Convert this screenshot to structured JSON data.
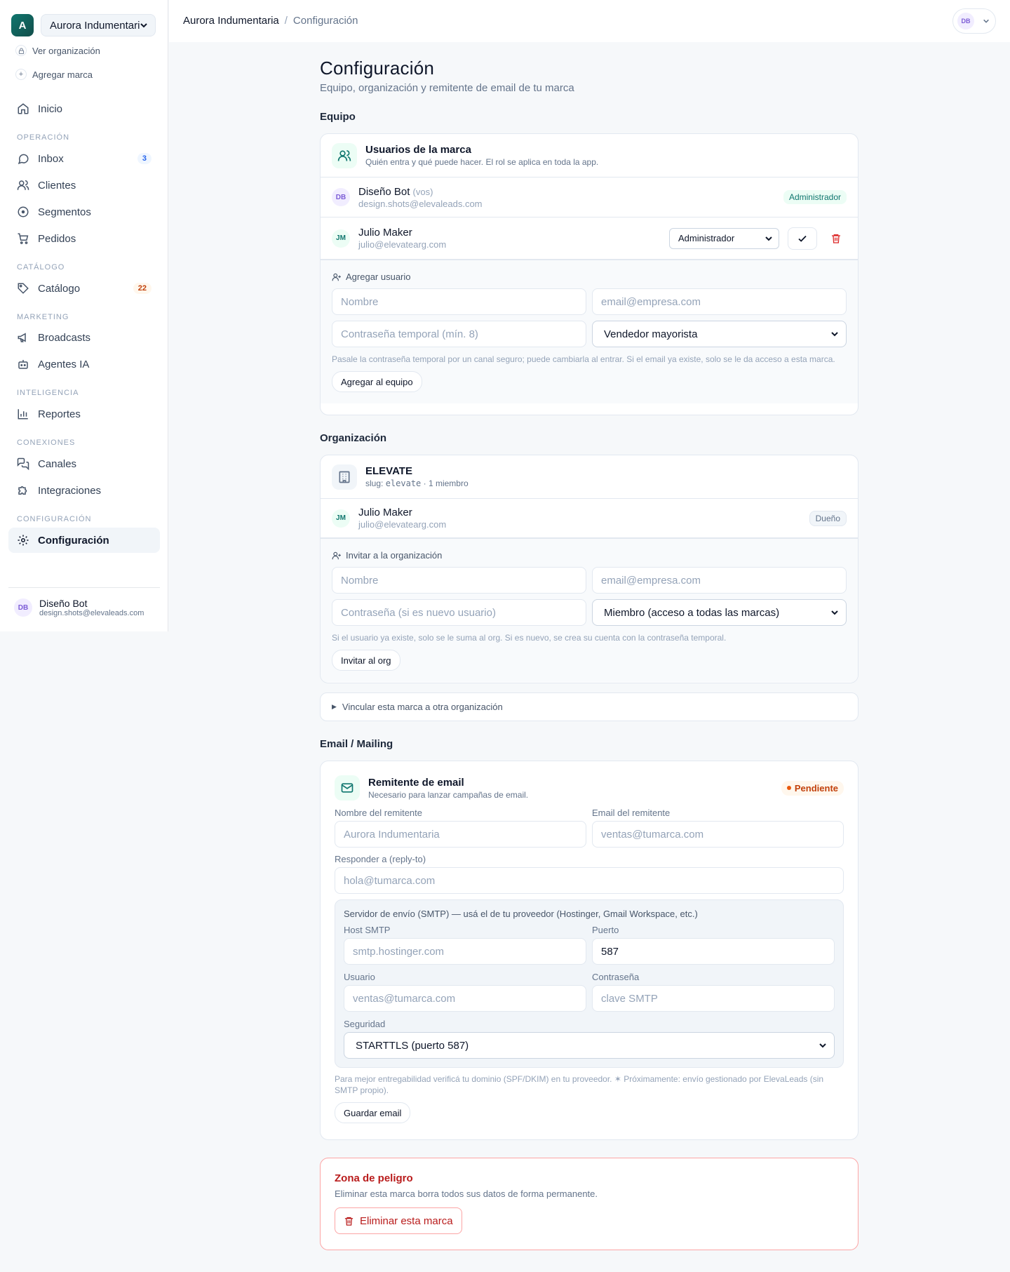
{
  "sidebar": {
    "brand_initial": "A",
    "brand_name": "Aurora Indumentaria",
    "view_org": "Ver organización",
    "add_brand": "Agregar marca",
    "home": "Inicio",
    "sections": {
      "operation": "OPERACIÓN",
      "catalog": "CATÁLOGO",
      "marketing": "MARKETING",
      "intelligence": "INTELIGENCIA",
      "connections": "CONEXIONES",
      "config": "CONFIGURACIÓN"
    },
    "items": {
      "inbox": "Inbox",
      "inbox_badge": "3",
      "clients": "Clientes",
      "segments": "Segmentos",
      "orders": "Pedidos",
      "catalog": "Catálogo",
      "catalog_badge": "22",
      "broadcasts": "Broadcasts",
      "agents": "Agentes IA",
      "reports": "Reportes",
      "channels": "Canales",
      "integrations": "Integraciones",
      "settings": "Configuración"
    },
    "user": {
      "initials": "DB",
      "name": "Diseño Bot",
      "email": "design.shots@elevaleads.com"
    }
  },
  "topbar": {
    "crumb_brand": "Aurora Indumentaria",
    "crumb_sep": "/",
    "crumb_page": "Configuración",
    "user_initials": "DB"
  },
  "page": {
    "title": "Configuración",
    "subtitle": "Equipo, organización y remitente de email de tu marca"
  },
  "team": {
    "section": "Equipo",
    "title": "Usuarios de la marca",
    "desc": "Quién entra y qué puede hacer. El rol se aplica en toda la app.",
    "members": [
      {
        "initials": "DB",
        "name": "Diseño Bot",
        "you": "(vos)",
        "email": "design.shots@elevaleads.com",
        "role": "Administrador"
      },
      {
        "initials": "JM",
        "name": "Julio Maker",
        "email": "julio@elevatearg.com",
        "role": "Administrador"
      }
    ],
    "add_label": "Agregar usuario",
    "name_placeholder": "Nombre",
    "email_placeholder": "email@empresa.com",
    "password_placeholder": "Contraseña temporal (mín. 8)",
    "role_value": "Vendedor mayorista",
    "hint": "Pasale la contraseña temporal por un canal seguro; puede cambiarla al entrar. Si el email ya existe, solo se le da acceso a esta marca.",
    "submit": "Agregar al equipo"
  },
  "org": {
    "section": "Organización",
    "name": "ELEVATE",
    "slug_label": "slug:",
    "slug": "elevate",
    "members_count": "· 1 miembro",
    "owner": {
      "initials": "JM",
      "name": "Julio Maker",
      "email": "julio@elevatearg.com",
      "role": "Dueño"
    },
    "invite_label": "Invitar a la organización",
    "name_placeholder": "Nombre",
    "email_placeholder": "email@empresa.com",
    "password_placeholder": "Contraseña (si es nuevo usuario)",
    "role_value": "Miembro (acceso a todas las marcas)",
    "hint": "Si el usuario ya existe, solo se le suma al org. Si es nuevo, se crea su cuenta con la contraseña temporal.",
    "submit": "Invitar al org",
    "link_other": "Vincular esta marca a otra organización"
  },
  "email": {
    "section": "Email / Mailing",
    "title": "Remitente de email",
    "desc": "Necesario para lanzar campañas de email.",
    "status": "Pendiente",
    "sender_name_label": "Nombre del remitente",
    "sender_name_placeholder": "Aurora Indumentaria",
    "sender_email_label": "Email del remitente",
    "sender_email_placeholder": "ventas@tumarca.com",
    "reply_to_label": "Responder a (reply-to)",
    "reply_to_placeholder": "hola@tumarca.com",
    "smtp": {
      "title": "Servidor de envío (SMTP) — usá el de tu proveedor (Hostinger, Gmail Workspace, etc.)",
      "host_label": "Host SMTP",
      "host_placeholder": "smtp.hostinger.com",
      "port_label": "Puerto",
      "port_value": "587",
      "user_label": "Usuario",
      "user_placeholder": "ventas@tumarca.com",
      "password_label": "Contraseña",
      "password_placeholder": "clave SMTP",
      "security_label": "Seguridad",
      "security_value": "STARTTLS (puerto 587)"
    },
    "hint": "Para mejor entregabilidad verificá tu dominio (SPF/DKIM) en tu proveedor. ✶ Próximamente: envío gestionado por ElevaLeads (sin SMTP propio).",
    "submit": "Guardar email"
  },
  "danger": {
    "title": "Zona de peligro",
    "desc": "Eliminar esta marca borra todos sus datos de forma permanente.",
    "button": "Eliminar esta marca"
  }
}
